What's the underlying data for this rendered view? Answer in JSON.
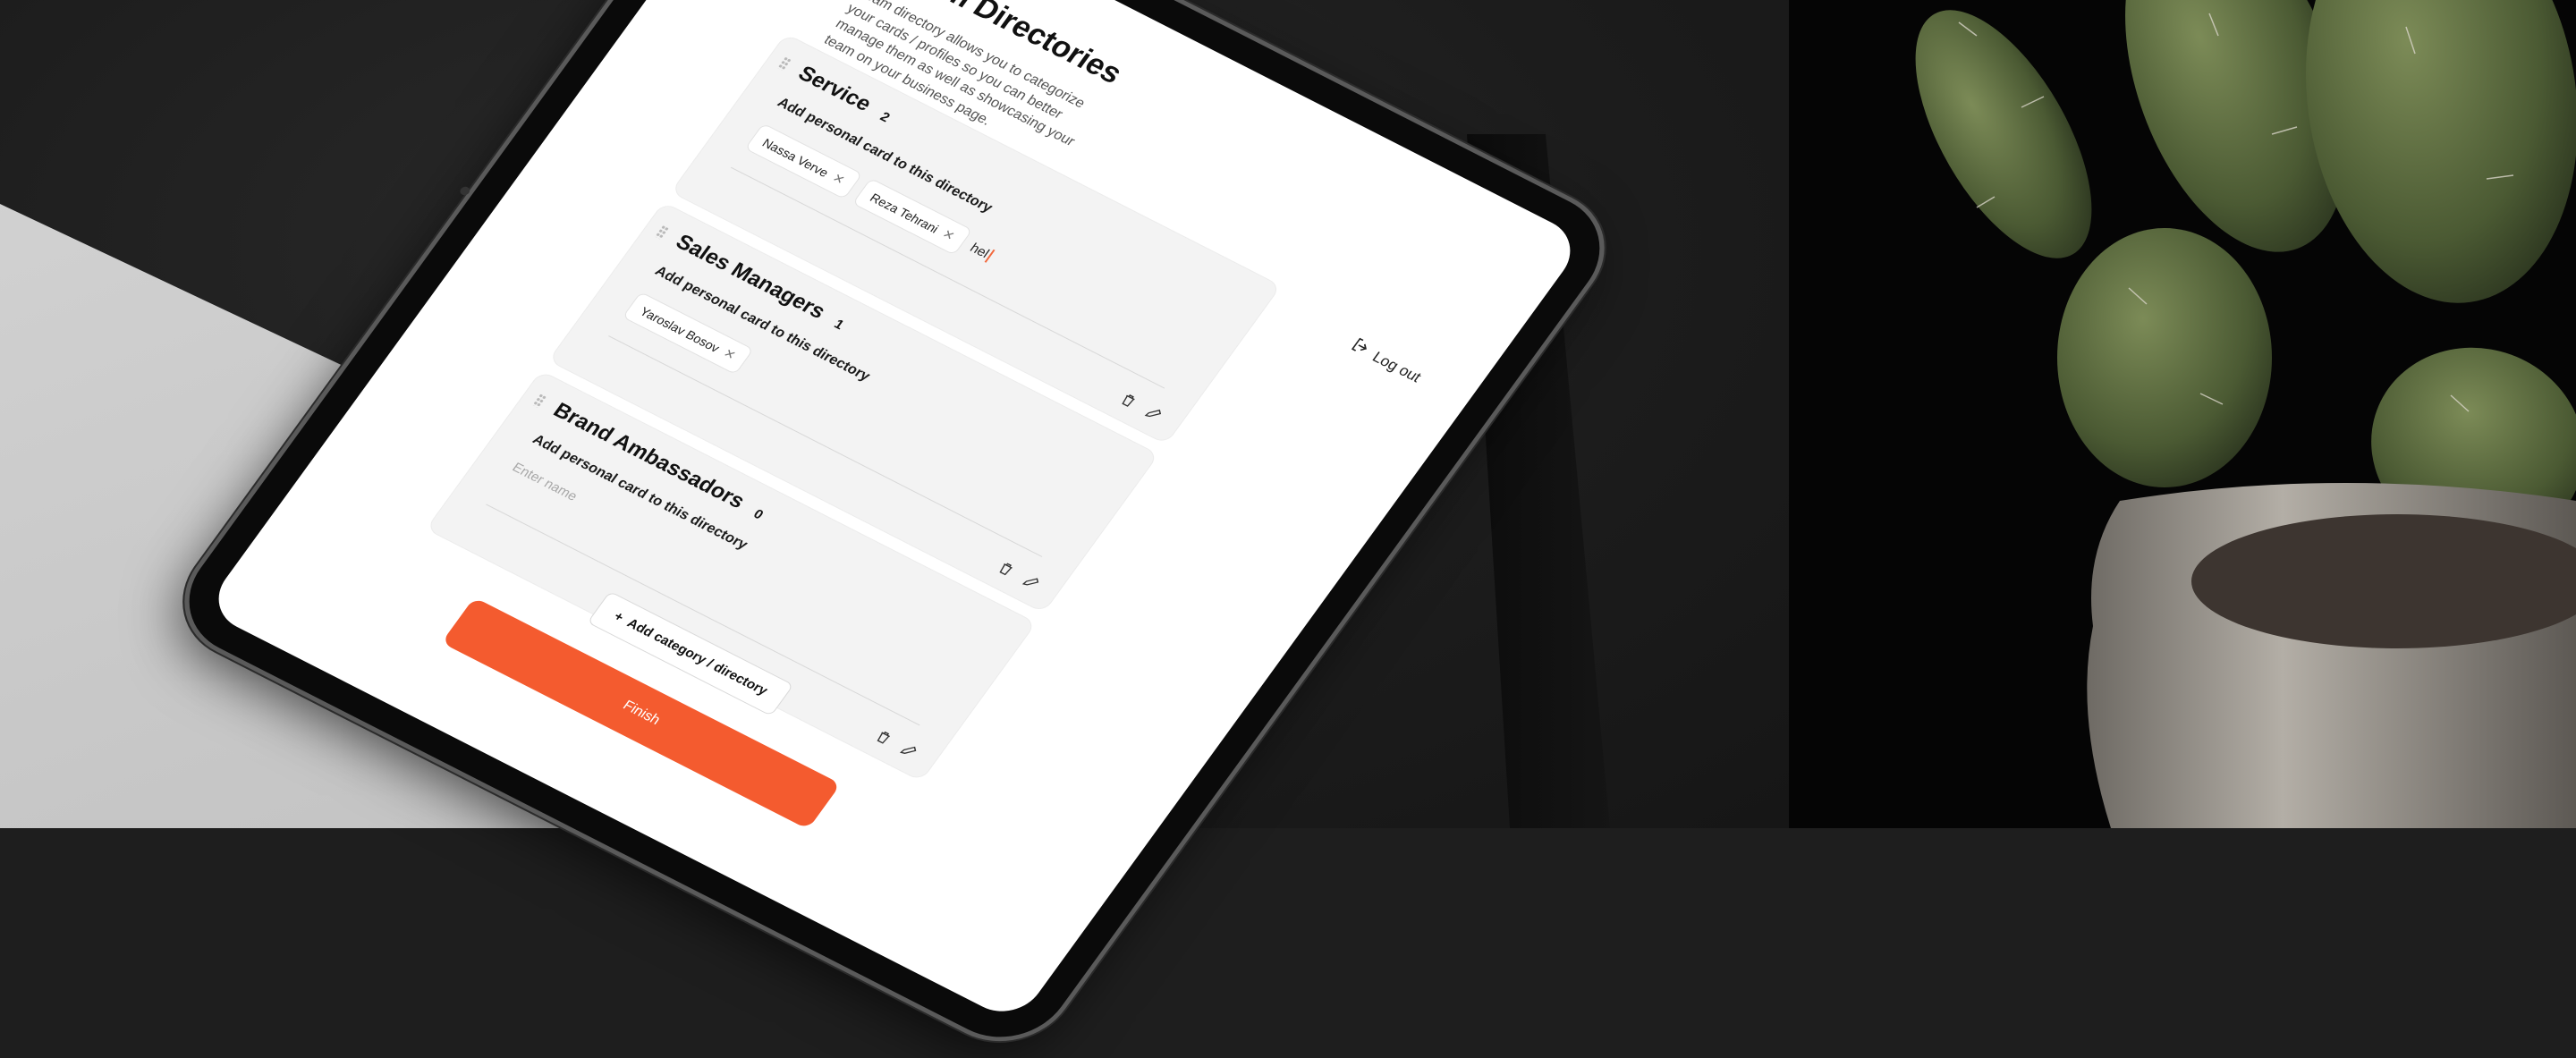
{
  "app": {
    "title": "Team Directories",
    "description": "Team directory allows you to categorize your cards / profiles so you can better manage them as well as showcasing your team on your business page.",
    "logout_label": "Log out"
  },
  "directories": [
    {
      "name": "Service",
      "count": "2",
      "subtitle": "Add personal card to this directory",
      "chips": [
        "Nassa Verve",
        "Reza Tehrani"
      ],
      "input_value": "hel",
      "input_placeholder": ""
    },
    {
      "name": "Sales Managers",
      "count": "1",
      "subtitle": "Add personal card to this directory",
      "chips": [
        "Yaroslav Bosov"
      ],
      "input_value": "",
      "input_placeholder": ""
    },
    {
      "name": "Brand Ambassadors",
      "count": "0",
      "subtitle": "Add personal card to this directory",
      "chips": [],
      "input_value": "",
      "input_placeholder": "Enter name"
    }
  ],
  "actions": {
    "add_category_label": "Add category / directory",
    "finish_label": "Finish"
  },
  "colors": {
    "accent": "#f45b2f",
    "card_bg": "#f3f3f3",
    "scene_dark": "#1e1e1e",
    "scene_light": "#c8c8c8"
  },
  "icons": {
    "logout": "logout-icon",
    "delete": "trash-icon",
    "edit": "pencil-icon",
    "add": "plus-icon",
    "remove_chip": "close-icon",
    "drag": "drag-handle-icon"
  }
}
